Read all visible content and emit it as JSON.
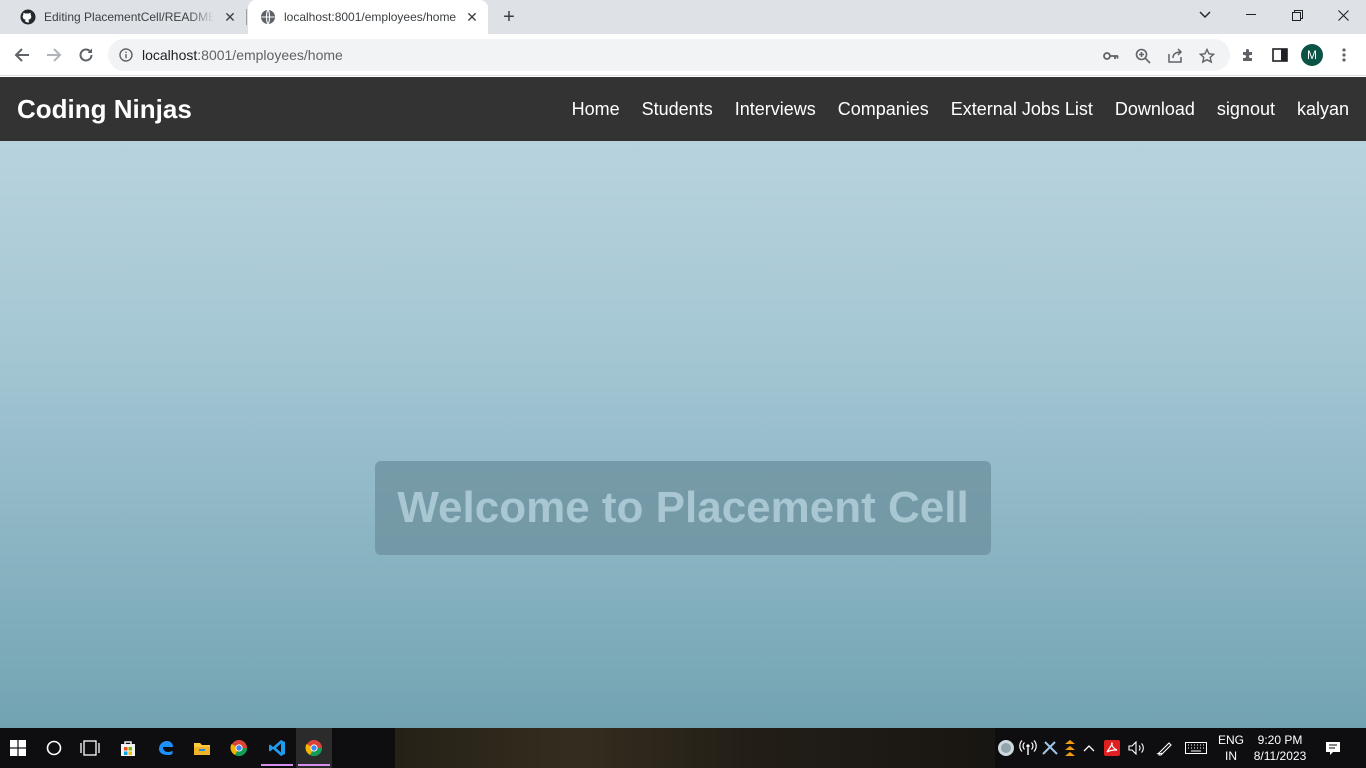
{
  "browser": {
    "tabs": [
      {
        "title": "Editing PlacementCell/README.md",
        "icon": "github-icon"
      },
      {
        "title": "localhost:8001/employees/home",
        "icon": "globe-icon"
      }
    ],
    "url_host": "localhost",
    "url_rest": ":8001/employees/home",
    "profile_initial": "M"
  },
  "site": {
    "brand": "Coding Ninjas",
    "nav": [
      "Home",
      "Students",
      "Interviews",
      "Companies",
      "External Jobs List",
      "Download",
      "signout",
      "kalyan"
    ],
    "hero_text": "Welcome to Placement Cell"
  },
  "taskbar": {
    "lang": "ENG",
    "region": "IN",
    "time": "9:20 PM",
    "date": "8/11/2023"
  },
  "colors": {
    "navbar": "#333333",
    "page_top": "#bed7e1",
    "page_bottom": "#72a3b2"
  }
}
